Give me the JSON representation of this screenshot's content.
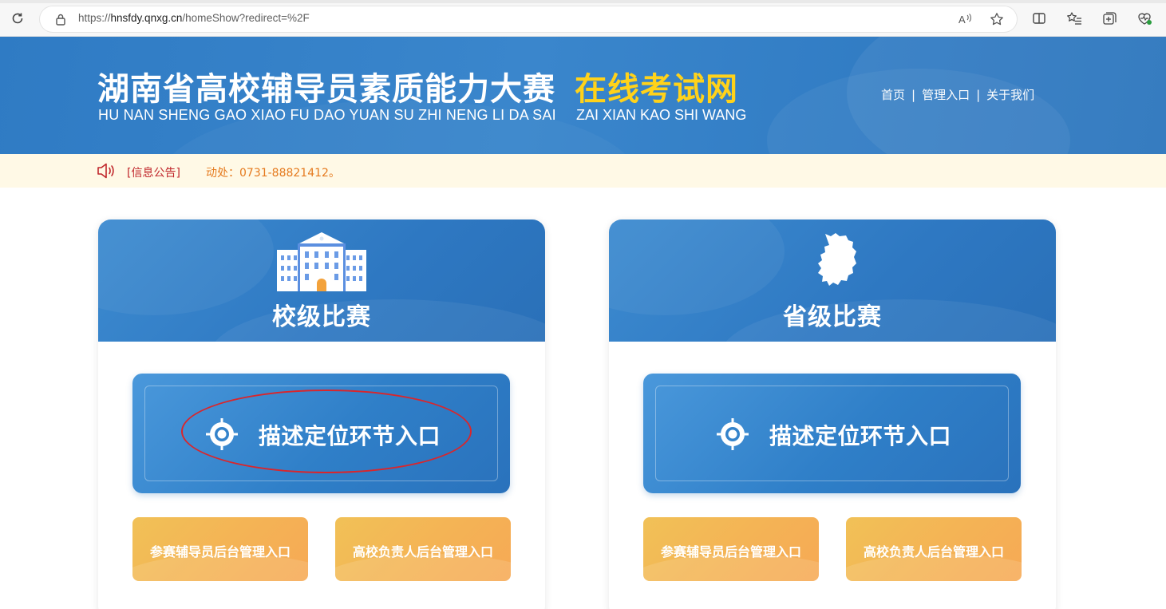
{
  "browser": {
    "url_prefix": "https://",
    "url_host": "hnsfdy.qnxg.cn",
    "url_path": "/homeShow?redirect=%2F"
  },
  "header": {
    "title_cn": "湖南省高校辅导员素质能力大赛",
    "title_cn_highlight": "在线考试网",
    "title_pinyin": "HU NAN SHENG GAO XIAO FU DAO YUAN SU ZHI NENG LI DA SAI",
    "title_pinyin_highlight": "ZAI XIAN KAO SHI WANG",
    "nav": {
      "home": "首页",
      "admin": "管理入口",
      "about": "关于我们",
      "separator": "|"
    }
  },
  "notice": {
    "label": "[信息公告]",
    "text": "动处：0731-88821412。"
  },
  "cards": [
    {
      "title": "校级比赛",
      "illustration": "school-building-icon",
      "main_button": "描述定位环节入口",
      "sub_buttons": [
        "参赛辅导员后台管理入口",
        "高校负责人后台管理入口"
      ]
    },
    {
      "title": "省级比赛",
      "illustration": "hunan-map-icon",
      "main_button": "描述定位环节入口",
      "sub_buttons": [
        "参赛辅导员后台管理入口",
        "高校负责人后台管理入口"
      ]
    }
  ],
  "colors": {
    "banner_blue": "#2f7bc4",
    "highlight_yellow": "#ffd21a",
    "notice_bg": "#fff9e6",
    "notice_label": "#c0262b",
    "notice_text": "#e57a1e",
    "sub_button_orange": "#f4b455",
    "annotation_red": "#d9262c"
  }
}
